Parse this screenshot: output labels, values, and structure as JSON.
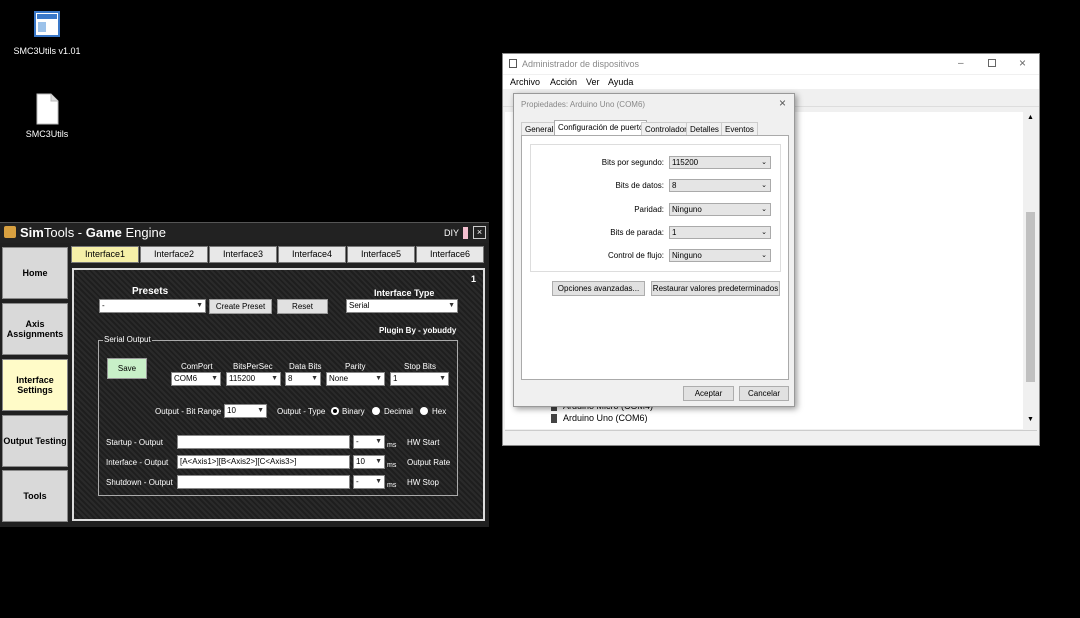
{
  "desktop": {
    "icons": [
      {
        "label": "SMC3Utils v1.01"
      },
      {
        "label": "SMC3Utils"
      }
    ]
  },
  "simtools": {
    "title_sim": "Sim",
    "title_tools": "Tools - ",
    "title_game": "Game",
    "title_engine": " Engine",
    "diy": "DIY",
    "close": "×",
    "nav": [
      "Home",
      "Axis Assignments",
      "Interface Settings",
      "Output Testing",
      "Tools"
    ],
    "tabs": [
      "Interface1",
      "Interface2",
      "Interface3",
      "Interface4",
      "Interface5",
      "Interface6"
    ],
    "panel_number": "1",
    "presets_label": "Presets",
    "presets_value": "-",
    "create_preset": "Create Preset",
    "reset": "Reset",
    "interface_type_label": "Interface Type",
    "interface_type_value": "Serial",
    "plugin_by": "Plugin By - yobuddy",
    "serial_output_legend": "Serial Output",
    "save": "Save",
    "comport_label": "ComPort",
    "comport_value": "COM6",
    "bits_per_sec_label": "BitsPerSec",
    "bits_per_sec_value": "115200",
    "data_bits_label": "Data Bits",
    "data_bits_value": "8",
    "parity_label": "Parity",
    "parity_value": "None",
    "stop_bits_label": "Stop Bits",
    "stop_bits_value": "1",
    "bit_range_label": "Output - Bit Range",
    "bit_range_value": "10",
    "output_type_label": "Output - Type",
    "output_type_options": [
      "Binary",
      "Decimal",
      "Hex"
    ],
    "output_type_selected": "Binary",
    "startup_label": "Startup - Output",
    "startup_value": "",
    "startup_ms": "-",
    "interface_label": "Interface - Output",
    "interface_value": "[A<Axis1>][B<Axis2>][C<Axis3>]",
    "interface_ms": "10",
    "shutdown_label": "Shutdown - Output",
    "shutdown_value": "",
    "shutdown_ms": "-",
    "ms": "ms",
    "hw_start": "HW Start",
    "output_rate": "Output Rate",
    "hw_stop": "HW Stop"
  },
  "device_manager": {
    "title": "Administrador de dispositivos",
    "menu": [
      "Archivo",
      "Acción",
      "Ver",
      "Ayuda"
    ],
    "tree_items": [
      "Arduino Micro (COM4)",
      "Arduino Uno (COM6)"
    ]
  },
  "properties": {
    "title": "Propiedades: Arduino Uno (COM6)",
    "tabs": [
      "General",
      "Configuración de puerto",
      "Controlador",
      "Detalles",
      "Eventos"
    ],
    "fields": [
      {
        "label": "Bits por segundo:",
        "value": "115200"
      },
      {
        "label": "Bits de datos:",
        "value": "8"
      },
      {
        "label": "Paridad:",
        "value": "Ninguno"
      },
      {
        "label": "Bits de parada:",
        "value": "1"
      },
      {
        "label": "Control de flujo:",
        "value": "Ninguno"
      }
    ],
    "advanced": "Opciones avanzadas...",
    "restore": "Restaurar valores predeterminados",
    "ok": "Aceptar",
    "cancel": "Cancelar"
  }
}
